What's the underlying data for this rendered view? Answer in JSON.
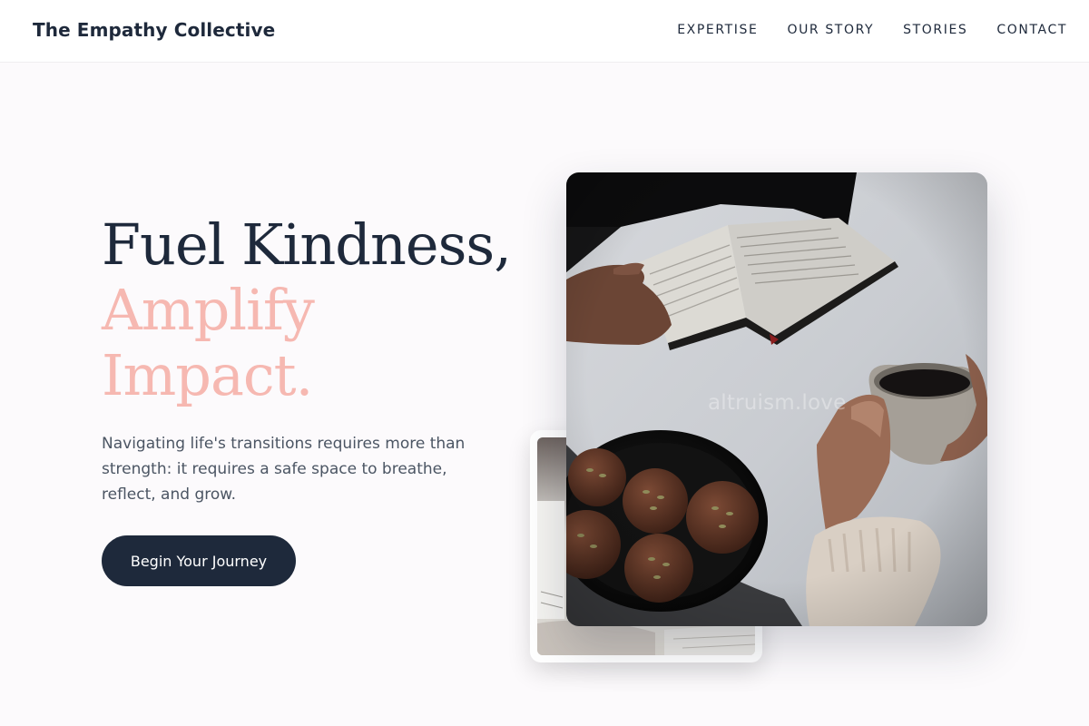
{
  "header": {
    "brand": "The Empathy Collective",
    "nav": [
      {
        "label": "EXPERTISE"
      },
      {
        "label": "OUR STORY"
      },
      {
        "label": "STORIES"
      },
      {
        "label": "CONTACT"
      }
    ]
  },
  "hero": {
    "headline_line1": "Fuel Kindness,",
    "headline_line2": "Amplify",
    "headline_line3": "Impact.",
    "lede": "Navigating life's transitions requires more than strength: it requires a safe space to breathe, reflect, and grow.",
    "cta_label": "Begin Your Journey",
    "image_watermark": "altruism.love"
  },
  "colors": {
    "ink": "#1e293b",
    "accent_pink": "#f6b8b1",
    "body_text": "#4b5563",
    "page_background": "#fcfafc"
  }
}
